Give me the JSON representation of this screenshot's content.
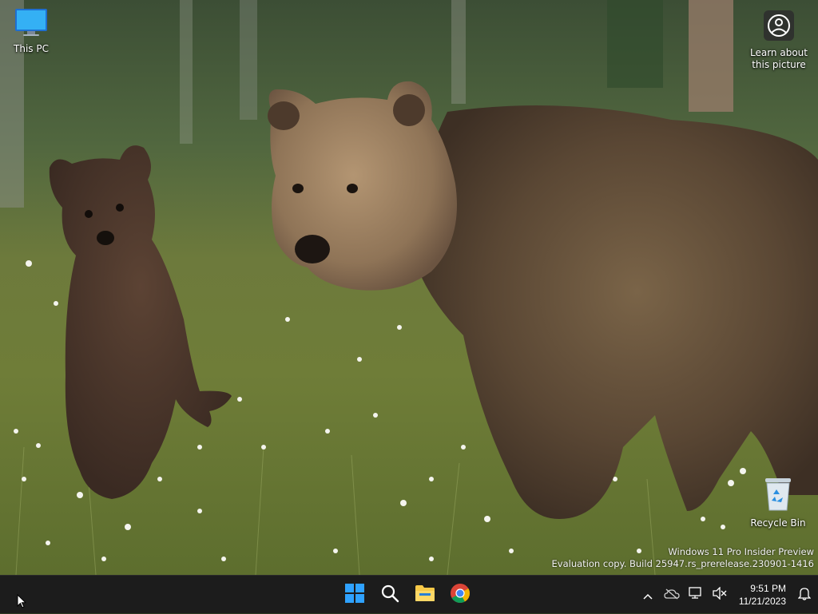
{
  "desktop": {
    "icons": [
      {
        "id": "this-pc",
        "label": "This PC",
        "icon": "monitor-icon"
      },
      {
        "id": "learn",
        "label_line1": "Learn about",
        "label_line2": "this picture",
        "icon": "camera-info-icon"
      },
      {
        "id": "recycle-bin",
        "label": "Recycle Bin",
        "icon": "recycle-bin-icon"
      }
    ],
    "watermark": {
      "line1": "Windows 11 Pro Insider Preview",
      "line2": "Evaluation copy. Build 25947.rs_prerelease.230901-1416"
    }
  },
  "taskbar": {
    "apps": [
      {
        "name": "Start",
        "icon": "windows-start-icon"
      },
      {
        "name": "Search",
        "icon": "search-icon"
      },
      {
        "name": "File Explorer",
        "icon": "folder-icon"
      },
      {
        "name": "Google Chrome",
        "icon": "chrome-icon"
      }
    ],
    "tray": {
      "time": "9:51 PM",
      "date": "11/21/2023",
      "icons": [
        "chevron-up-icon",
        "network-off-icon",
        "display-icon",
        "volume-muted-icon",
        "notification-bell-icon"
      ]
    }
  },
  "colors": {
    "taskbar_bg": "#1c1c1c",
    "windows_blue": "#2fa2ff",
    "folder_yellow": "#f7c948"
  }
}
